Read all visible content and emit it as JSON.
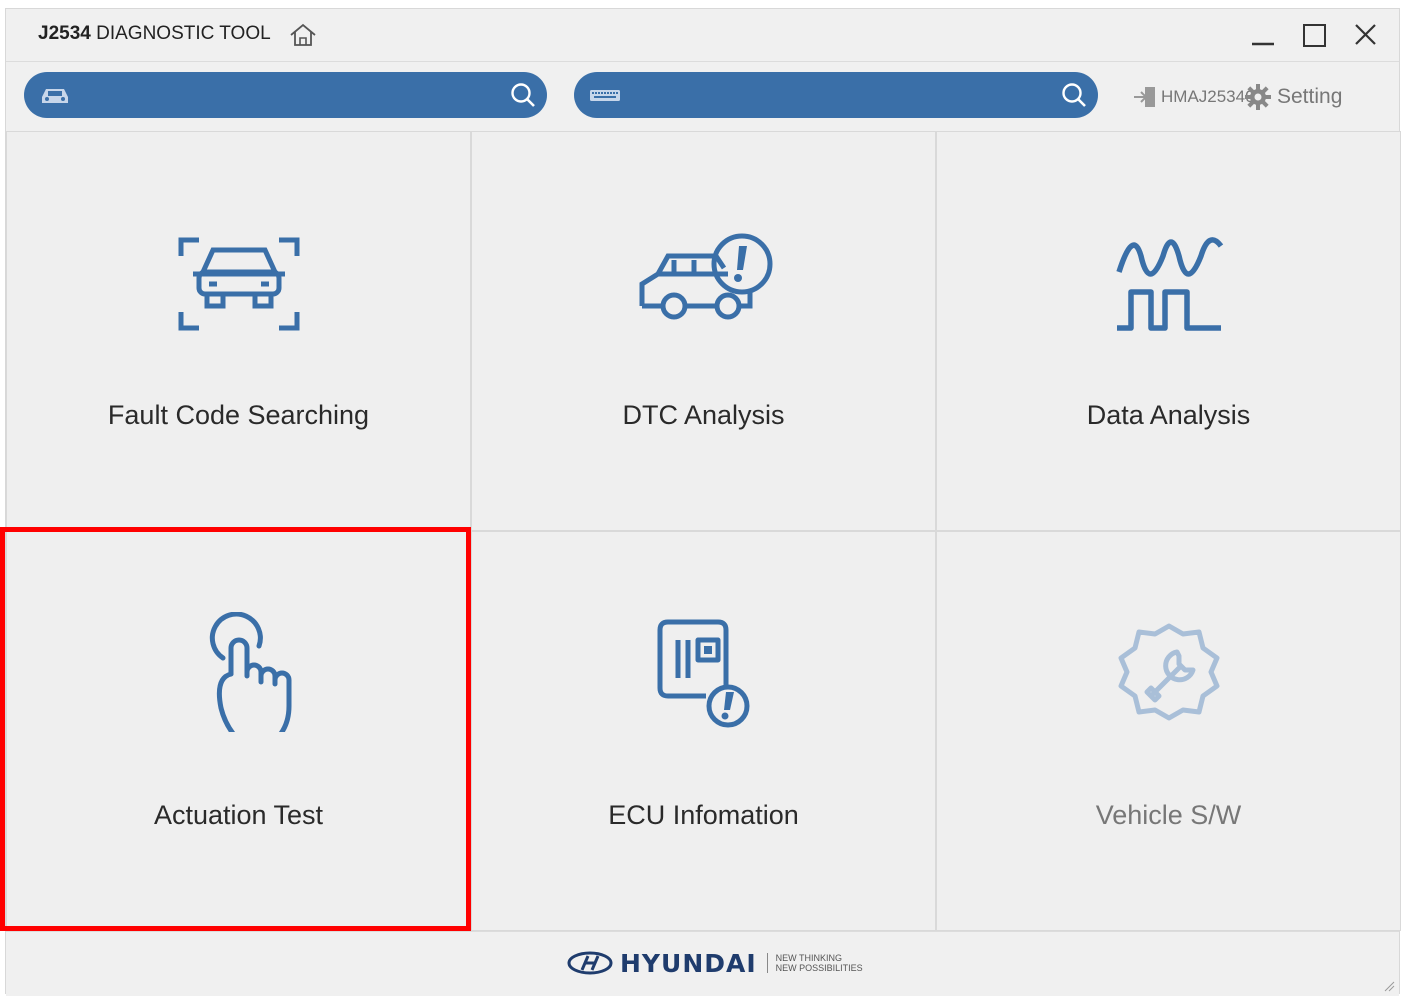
{
  "window": {
    "title_bold": "J2534",
    "title_rest": " DIAGNOSTIC TOOL"
  },
  "toolbar": {
    "vehicle_search": {
      "value": "",
      "icon": "car-icon"
    },
    "vin_search": {
      "value": "",
      "icon": "keyboard-icon"
    },
    "device_label": "HMAJ25340",
    "setting_label": "Setting"
  },
  "tiles": [
    {
      "label": "Fault Code Searching",
      "icon": "car-scan-icon",
      "enabled": true
    },
    {
      "label": "DTC Analysis",
      "icon": "car-alert-icon",
      "enabled": true
    },
    {
      "label": "Data Analysis",
      "icon": "waveform-icon",
      "enabled": true
    },
    {
      "label": "Actuation Test",
      "icon": "touch-hand-icon",
      "enabled": true
    },
    {
      "label": "ECU Infomation",
      "icon": "ecu-alert-icon",
      "enabled": true
    },
    {
      "label": "Vehicle S/W",
      "icon": "gear-wrench-icon",
      "enabled": false
    }
  ],
  "footer": {
    "brand": "HYUNDAI",
    "tagline_1": "NEW THINKING",
    "tagline_2": "NEW POSSIBILITIES"
  },
  "colors": {
    "accent": "#3a6fa8",
    "highlight": "#ff0000",
    "disabled_icon": "#a9bfd8"
  }
}
